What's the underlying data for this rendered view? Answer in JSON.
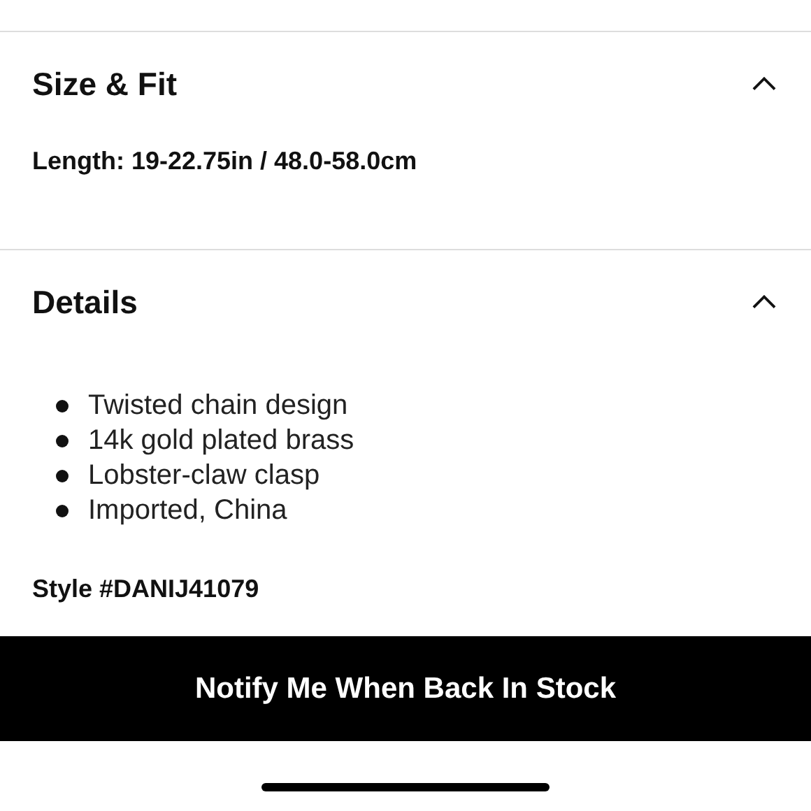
{
  "sections": [
    {
      "title": "Size & Fit",
      "expanded": true,
      "lines": [
        "Length: 19-22.75in / 48.0-58.0cm"
      ]
    },
    {
      "title": "Details",
      "expanded": true,
      "bullets": [
        "Twisted chain design",
        "14k gold plated brass",
        "Lobster-claw clasp",
        "Imported, China"
      ],
      "lines": [
        "Style #DANIJ41079"
      ]
    }
  ],
  "button": {
    "label": "Notify Me When Back In Stock"
  }
}
